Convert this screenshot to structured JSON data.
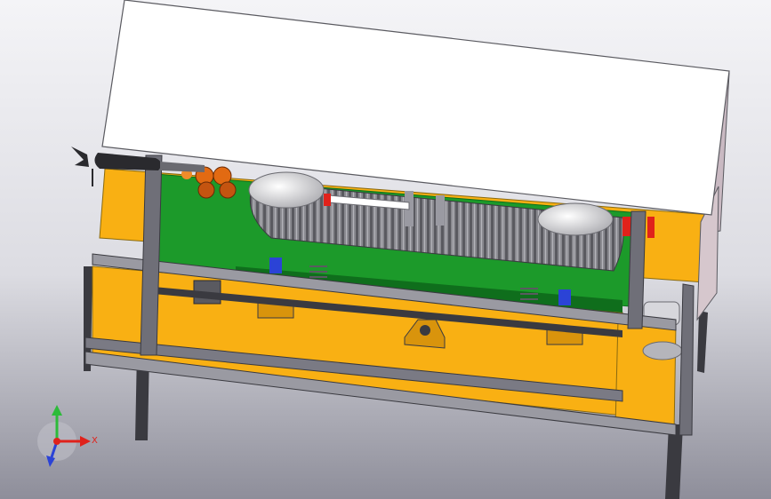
{
  "viewport": {
    "background_top": "#f4f4f7",
    "background_bottom": "#8e8e9a"
  },
  "colors": {
    "plate_yellow": "#f9b013",
    "plate_yellow_dark": "#d9940c",
    "board_green": "#1c9a2a",
    "board_green_dark": "#0f6e1c",
    "frame_grey": "#6f6f78",
    "frame_dark": "#3a3a40",
    "cover_white": "#ffffff",
    "accent_red": "#e0221b",
    "roller_grey": "#cfcfd2",
    "spring_orange": "#e26a12"
  },
  "triad": {
    "x_label": "X",
    "x_color": "#e0221b",
    "y_color": "#2dbb3a",
    "z_color": "#2b43d6"
  }
}
